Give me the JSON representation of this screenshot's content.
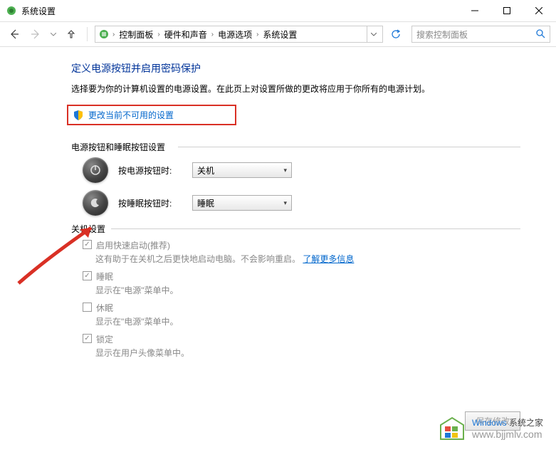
{
  "window": {
    "title": "系统设置"
  },
  "breadcrumb": {
    "items": [
      "控制面板",
      "硬件和声音",
      "电源选项",
      "系统设置"
    ]
  },
  "search": {
    "placeholder": "搜索控制面板"
  },
  "page": {
    "heading": "定义电源按钮并启用密码保护",
    "subtitle": "选择要为你的计算机设置的电源设置。在此页上对设置所做的更改将应用于你所有的电源计划。",
    "change_link": "更改当前不可用的设置",
    "section_power": "电源按钮和睡眠按钮设置",
    "power_button_label": "按电源按钮时:",
    "power_button_value": "关机",
    "sleep_button_label": "按睡眠按钮时:",
    "sleep_button_value": "睡眠",
    "section_shutdown": "关机设置",
    "fast_startup": {
      "label": "启用快速启动(推荐)",
      "desc_prefix": "这有助于在关机之后更快地启动电脑。不会影响重启。",
      "desc_link": "了解更多信息"
    },
    "sleep": {
      "label": "睡眠",
      "desc": "显示在\"电源\"菜单中。"
    },
    "hibernate": {
      "label": "休眠",
      "desc": "显示在\"电源\"菜单中。"
    },
    "lock": {
      "label": "锁定",
      "desc": "显示在用户头像菜单中。"
    },
    "save_btn": "保存修改"
  },
  "watermark": {
    "brand": "Windows",
    "site_cn": "系统之家",
    "site": "www.bjjmlv.com"
  }
}
